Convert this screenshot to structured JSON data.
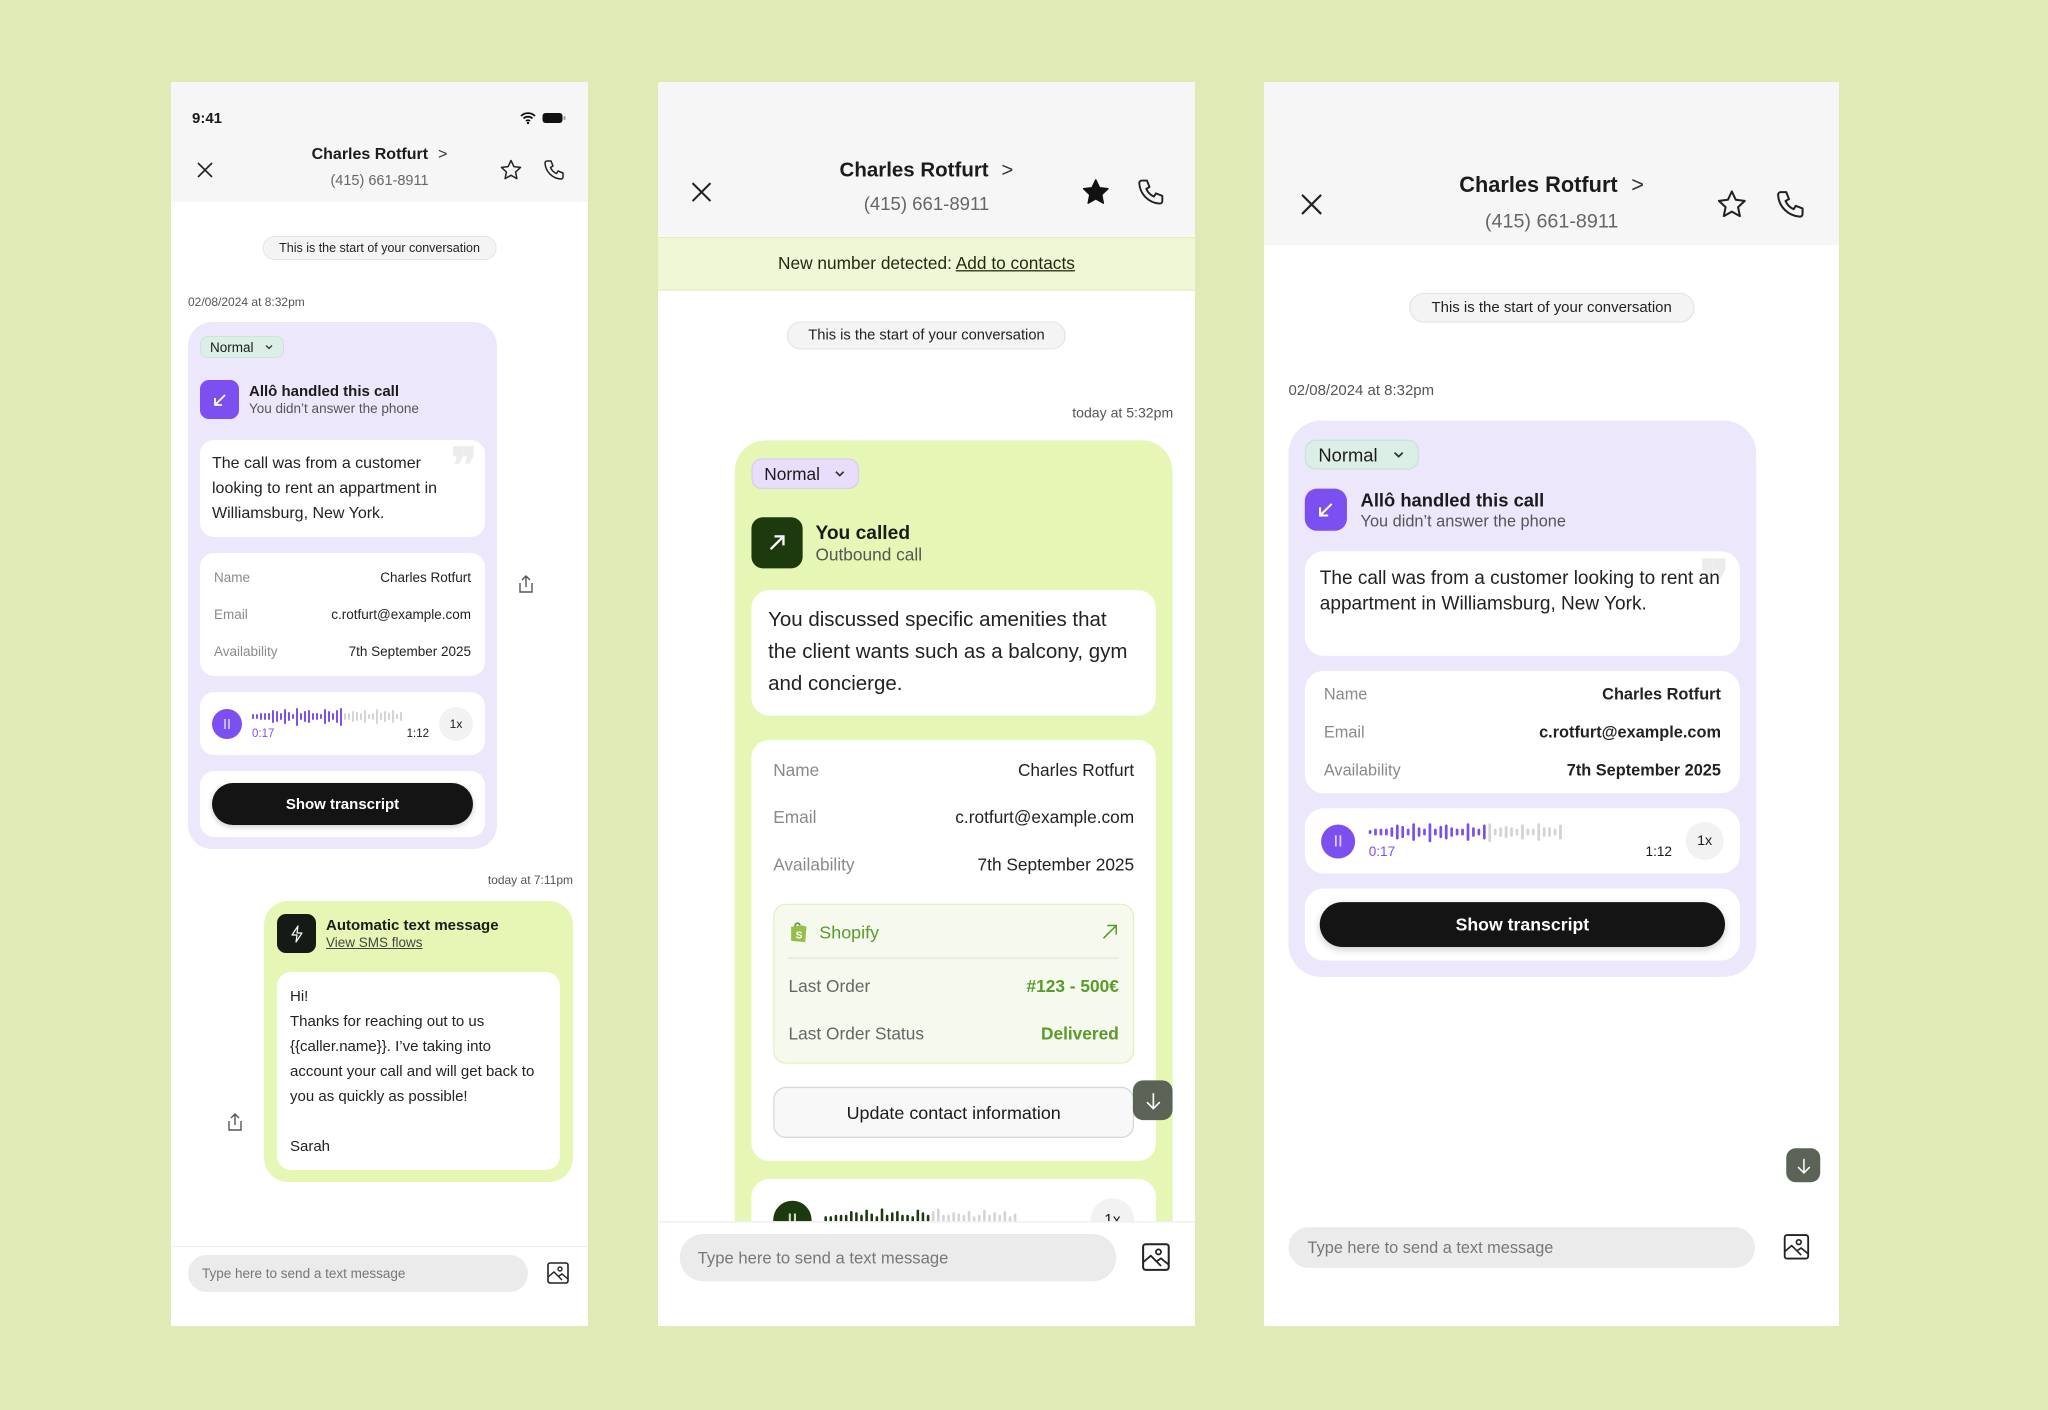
{
  "colors": {
    "background": "#dfeab6",
    "purple": "#7b4ff0",
    "allo_card": "#ece7fb",
    "green_card": "#e6f7b5",
    "dark_green": "#1d3a0f",
    "shopify_green": "#5a9a2a"
  },
  "p1": {
    "status": {
      "time": "9:41"
    },
    "header": {
      "name": "Charles Rotfurt",
      "chevron": ">",
      "phone": "(415) 661-8911",
      "star": "star-outline"
    },
    "start_pill": "This is the start of your conversation",
    "call": {
      "timestamp": "02/08/2024 at 8:32pm",
      "priority": "Normal",
      "title": "Allô handled this call",
      "subtitle": "You didn’t answer the phone",
      "summary": "The call was from a customer looking to rent an appartment in Williamsburg, New York.",
      "details": [
        {
          "label": "Name",
          "value": "Charles Rotfurt"
        },
        {
          "label": "Email",
          "value": "c.rotfurt@example.com"
        },
        {
          "label": "Availability",
          "value": "7th September 2025"
        }
      ],
      "audio": {
        "elapsed": "0:17",
        "duration": "1:12",
        "speed": "1x",
        "played_fraction": 0.6
      },
      "transcript_button": "Show transcript"
    },
    "sms": {
      "timestamp": "today at 7:11pm",
      "title": "Automatic text message",
      "link": "View SMS flows",
      "lines": [
        "Hi!",
        "Thanks for reaching out to us {{caller.name}}. I’ve taking into account your call and will get back to you as quickly as possible!",
        "",
        "Sarah"
      ]
    },
    "composer": {
      "placeholder": "Type here to send a text message"
    }
  },
  "p2": {
    "header": {
      "name": "Charles Rotfurt",
      "chevron": ">",
      "phone": "(415) 661-8911",
      "star": "star-filled"
    },
    "banner": {
      "text": "New number detected: ",
      "link": "Add to contacts"
    },
    "start_pill": "This is the start of your conversation",
    "call": {
      "timestamp": "today at 5:32pm",
      "priority": "Normal",
      "title": "You called",
      "subtitle": "Outbound call",
      "summary": "You discussed specific amenities that the client wants such as a balcony, gym and concierge.",
      "details": [
        {
          "label": "Name",
          "value": "Charles Rotfurt"
        },
        {
          "label": "Email",
          "value": "c.rotfurt@example.com"
        },
        {
          "label": "Availability",
          "value": "7th September 2025"
        }
      ],
      "shopify": {
        "title": "Shopify",
        "rows": [
          {
            "label": "Last Order",
            "value": "#123 - 500€"
          },
          {
            "label": "Last Order Status",
            "value": "Delivered"
          }
        ]
      },
      "update_button": "Update contact information",
      "audio": {
        "speed": "1x",
        "played_fraction": 0.55
      }
    },
    "composer": {
      "placeholder": "Type here to send a text message"
    }
  },
  "p3": {
    "header": {
      "name": "Charles Rotfurt",
      "chevron": ">",
      "phone": "(415) 661-8911",
      "star": "star-outline"
    },
    "start_pill": "This is the start of your conversation",
    "call": {
      "timestamp": "02/08/2024 at 8:32pm",
      "priority": "Normal",
      "title": "Allô handled this call",
      "subtitle": "You didn’t answer the phone",
      "summary": "The call was from a customer looking to rent an appartment in Williamsburg, New York.",
      "details": [
        {
          "label": "Name",
          "value": "Charles Rotfurt"
        },
        {
          "label": "Email",
          "value": "c.rotfurt@example.com"
        },
        {
          "label": "Availability",
          "value": "7th September 2025"
        }
      ],
      "audio": {
        "elapsed": "0:17",
        "duration": "1:12",
        "speed": "1x",
        "played_fraction": 0.6
      },
      "transcript_button": "Show transcript"
    },
    "composer": {
      "placeholder": "Type here to send a text message"
    }
  }
}
